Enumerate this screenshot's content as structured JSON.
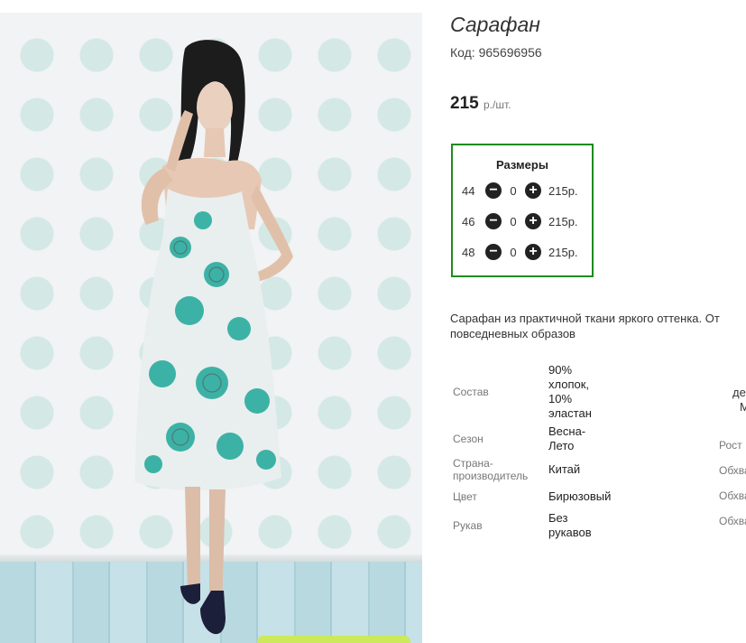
{
  "product": {
    "title": "Сарафан",
    "code": "Код: 965696956",
    "price": "215",
    "price_unit": "р./шт."
  },
  "sizes": {
    "heading": "Размеры",
    "rows": [
      {
        "size": "44",
        "qty": "0",
        "price": "215р."
      },
      {
        "size": "46",
        "qty": "0",
        "price": "215р."
      },
      {
        "size": "48",
        "qty": "0",
        "price": "215р."
      }
    ],
    "minus_icon": "minus-circle-icon",
    "plus_icon": "plus-circle-icon"
  },
  "description": {
    "line1": "Сарафан из практичной ткани яркого оттенка. От",
    "line2": "повседневных образов"
  },
  "specs": [
    {
      "label": "Состав",
      "value_lines": [
        "90%",
        "хлопок,",
        "10%",
        "эластан"
      ]
    },
    {
      "label": "Сезон",
      "value_lines": [
        "Весна-",
        "Лето"
      ]
    },
    {
      "label_lines": [
        "Страна-",
        "производитель"
      ],
      "value_lines": [
        "Китай"
      ]
    },
    {
      "label": "Цвет",
      "value_lines": [
        "Бирюзовый"
      ]
    },
    {
      "label": "Рукав",
      "value_lines": [
        "Без",
        "рукавов"
      ]
    }
  ],
  "cut_off_right": {
    "line_a": "де",
    "line_b": "М",
    "rost": "Рост",
    "obkhv1": "Обхва",
    "obkhv2": "Обхва",
    "obkhv3": "Обхва"
  },
  "colors": {
    "accent_border": "#1e8c1e",
    "dress_teal": "#1fa89a"
  }
}
